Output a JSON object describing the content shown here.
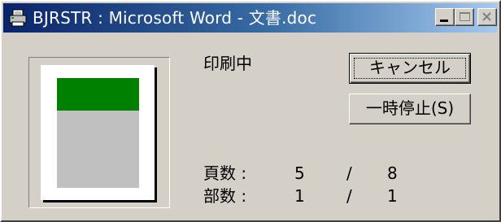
{
  "window": {
    "title": "BJRSTR : Microsoft Word - 文書.doc",
    "icon": "printer-icon",
    "controls": [
      "minimize-icon",
      "maximize-icon",
      "close-icon"
    ]
  },
  "status_text": "印刷中",
  "buttons": {
    "cancel": "キャンセル",
    "pause": "一時停止(S)"
  },
  "counters": {
    "pages": {
      "label": "頁数 :",
      "current": "5",
      "separator": "/",
      "total": "8"
    },
    "copies": {
      "label": "部数 :",
      "current": "1",
      "separator": "/",
      "total": "1"
    }
  },
  "colors": {
    "titlebar_start": "#0a246a",
    "titlebar_end": "#a6caf0",
    "face": "#d4d0c8",
    "preview_green": "#008000",
    "preview_gray": "#c0c0c0"
  }
}
